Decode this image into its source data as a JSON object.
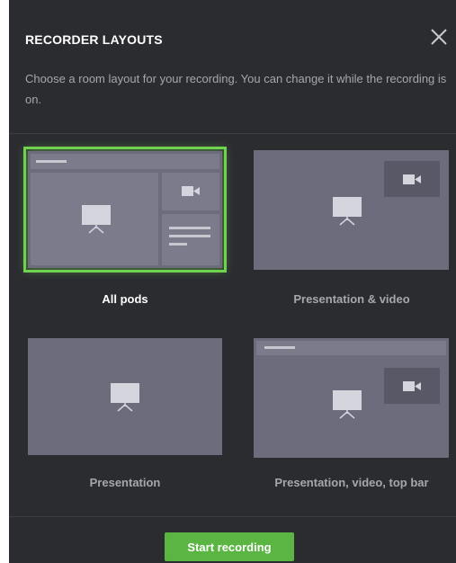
{
  "dialog": {
    "title": "RECORDER LAYOUTS",
    "description": "Choose a room layout for your recording. You can change it while the recording is on."
  },
  "layouts": [
    {
      "label": "All pods",
      "selected": true
    },
    {
      "label": "Presentation & video",
      "selected": false
    },
    {
      "label": "Presentation",
      "selected": false
    },
    {
      "label": "Presentation, video, top bar",
      "selected": false
    }
  ],
  "footer": {
    "start_button": "Start recording"
  },
  "icons": {
    "close": "close-icon",
    "presentation": "presentation-easel-icon",
    "video": "video-camera-icon"
  },
  "colors": {
    "accent": "#6fd34f",
    "button": "#5ab543",
    "background": "#2b2c30"
  }
}
